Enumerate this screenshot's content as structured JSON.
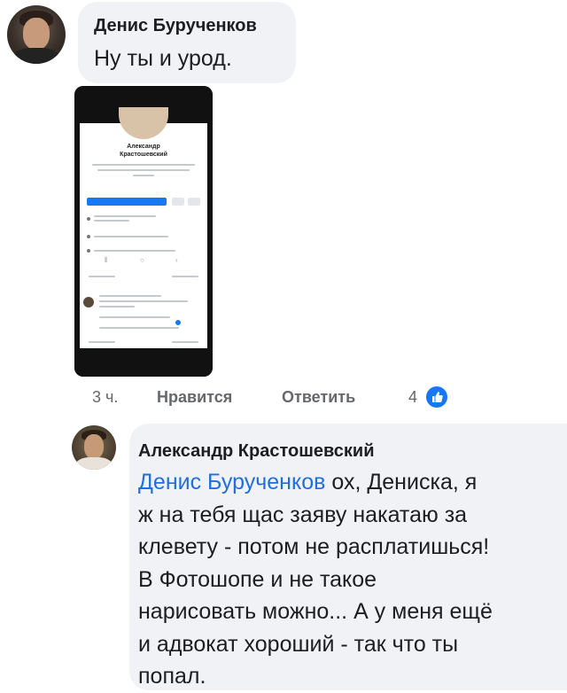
{
  "comment_1": {
    "author": "Денис Бурученков",
    "text": "Ну ты и урод.",
    "embedded_screenshot": {
      "profile_name": "Александр\nКрастошевский"
    }
  },
  "comment_1_actions": {
    "time": "3 ч.",
    "like_label": "Нравится",
    "reply_label": "Ответить",
    "reaction_count": "4",
    "reaction_icon": "thumbs-up-icon"
  },
  "comment_2": {
    "author": "Александр Крастошевский",
    "mention": "Денис Бурученков",
    "lines": [
      " ох, Дениска, я",
      "ж на тебя щас заяву накатаю за",
      "клевету - потом не расплатишься!",
      "В Фотошопе и не такое",
      "нарисовать можно... А у меня ещё",
      "и адвокат хороший - так что ты",
      "попал."
    ]
  },
  "colors": {
    "bubble_bg": "#f0f2f5",
    "mention": "#216fdb",
    "like_blue": "#1877f2",
    "meta_gray": "#65676b"
  }
}
